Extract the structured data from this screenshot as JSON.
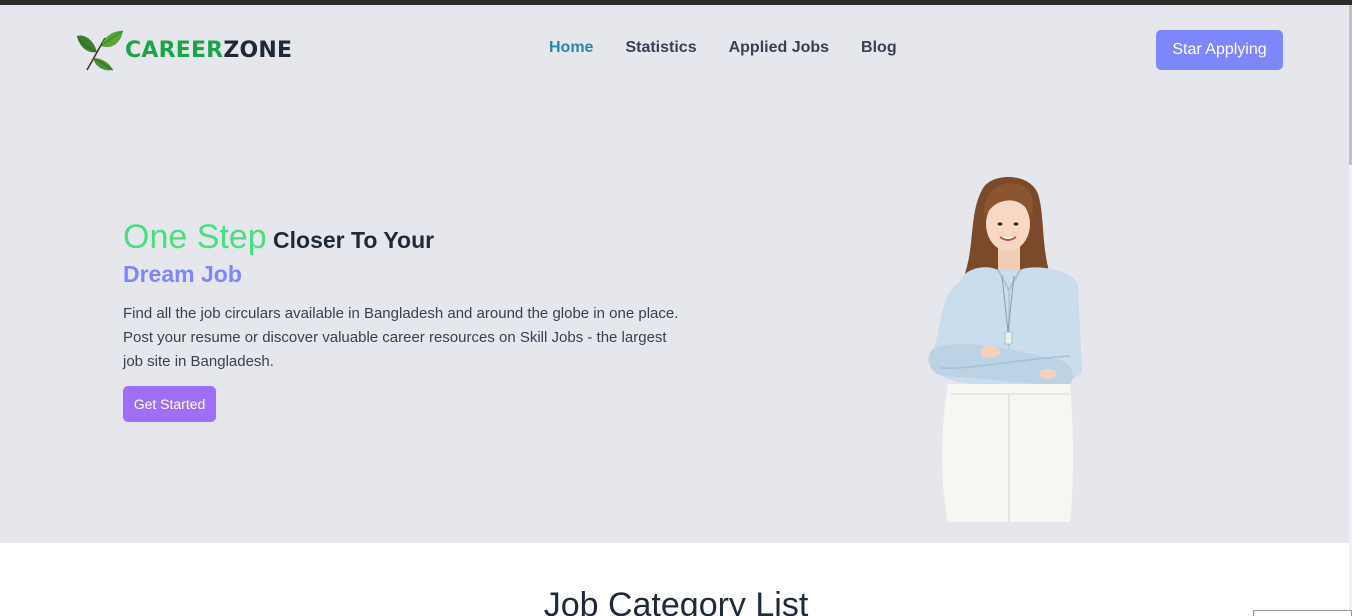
{
  "brand": {
    "part1": "CAREER",
    "part2": "ZONE",
    "icon": "leaf-icon"
  },
  "nav": {
    "items": [
      {
        "label": "Home",
        "active": true
      },
      {
        "label": "Statistics",
        "active": false
      },
      {
        "label": "Applied Jobs",
        "active": false
      },
      {
        "label": "Blog",
        "active": false
      }
    ]
  },
  "header": {
    "cta_label": "Star Applying"
  },
  "hero": {
    "headline_highlight": "One Step",
    "headline_rest": " Closer To Your",
    "headline_line2": "Dream Job",
    "description": "Find all the job circulars available in Bangladesh and around the globe in one place. Post your resume or discover valuable career resources on Skill Jobs - the largest job site in Bangladesh.",
    "button_label": "Get Started",
    "image": "woman-arms-crossed-photo"
  },
  "section": {
    "title": "Job Category List"
  },
  "colors": {
    "brand_green": "#1aa54a",
    "accent_green": "#4ade80",
    "accent_blue": "#7e86fb",
    "accent_purple": "#9f6ef7",
    "nav_active": "#2489a8",
    "hero_bg": "#e6e7ec"
  }
}
